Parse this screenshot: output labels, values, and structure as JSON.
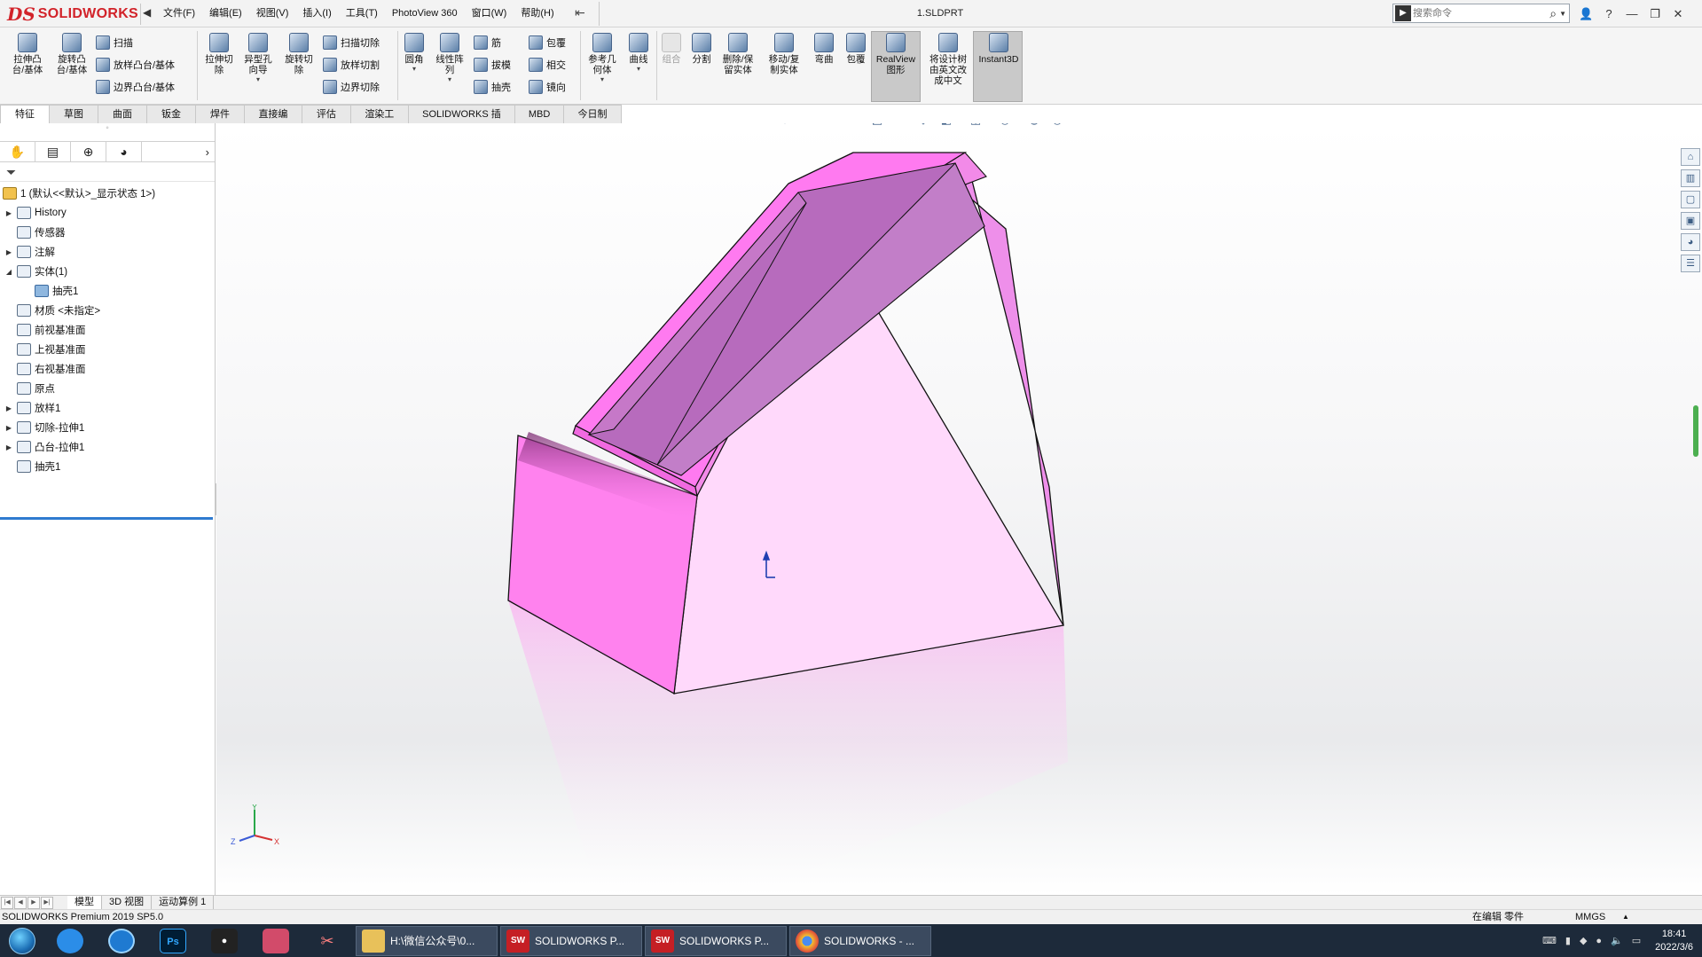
{
  "app": {
    "logo_ds": "DS",
    "logo_text": "SOLIDWORKS",
    "doc_title": "1.SLDPRT"
  },
  "menu": [
    "文件(F)",
    "编辑(E)",
    "视图(V)",
    "插入(I)",
    "工具(T)",
    "PhotoView 360",
    "窗口(W)",
    "帮助(H)"
  ],
  "search": {
    "placeholder": "搜索命令"
  },
  "window_buttons": [
    "?",
    "—",
    "❐",
    "✕"
  ],
  "ribbon": {
    "extrude_boss": "拉伸凸\n台/基体",
    "revolve_boss": "旋转凸\n台/基体",
    "sweep": "扫描",
    "loft_boss": "放样凸台/基体",
    "boundary_boss": "边界凸台/基体",
    "extrude_cut": "拉伸切\n除",
    "hole_wizard": "异型孔\n向导",
    "revolve_cut": "旋转切\n除",
    "sweep_cut": "扫描切除",
    "loft_cut": "放样切割",
    "boundary_cut": "边界切除",
    "fillet": "圆角",
    "linear_pattern": "线性阵\n列",
    "rib": "筋",
    "draft": "拔模",
    "shell": "抽壳",
    "wrap": "包覆",
    "intersect": "相交",
    "mirror": "镜向",
    "ref_geometry": "参考几\n何体",
    "curves": "曲线",
    "combine": "组合",
    "split": "分割",
    "delete_keep": "删除/保\n留实体",
    "move_copy": "移动/复\n制实体",
    "flex": "弯曲",
    "wrap2": "包覆",
    "realview": "RealView\n图形",
    "translate_tree": "将设计树\n由英文改\n成中文",
    "instant3d": "Instant3D"
  },
  "tabs": [
    "特征",
    "草图",
    "曲面",
    "钣金",
    "焊件",
    "直接编辑",
    "评估",
    "渲染工具",
    "SOLIDWORKS 插件",
    "MBD",
    "今日制造"
  ],
  "tree": {
    "root": "1  (默认<<默认>_显示状态 1>)",
    "items": [
      {
        "label": "History",
        "expandable": true,
        "indent": 1
      },
      {
        "label": "传感器",
        "expandable": false,
        "indent": 1
      },
      {
        "label": "注解",
        "expandable": true,
        "indent": 1
      },
      {
        "label": "实体(1)",
        "expandable": true,
        "expanded": true,
        "indent": 1
      },
      {
        "label": "抽壳1",
        "expandable": false,
        "indent": 2,
        "icon": "blue"
      },
      {
        "label": "材质 <未指定>",
        "expandable": false,
        "indent": 1
      },
      {
        "label": "前视基准面",
        "expandable": false,
        "indent": 1
      },
      {
        "label": "上视基准面",
        "expandable": false,
        "indent": 1
      },
      {
        "label": "右视基准面",
        "expandable": false,
        "indent": 1
      },
      {
        "label": "原点",
        "expandable": false,
        "indent": 1
      },
      {
        "label": "放样1",
        "expandable": true,
        "indent": 1
      },
      {
        "label": "切除-拉伸1",
        "expandable": true,
        "indent": 1
      },
      {
        "label": "凸台-拉伸1",
        "expandable": true,
        "indent": 1
      },
      {
        "label": "抽壳1",
        "expandable": false,
        "indent": 1
      }
    ]
  },
  "viewport": {
    "model_color": "#ff80ee",
    "triad_labels": {
      "x": "X",
      "y": "Y",
      "z": "Z"
    }
  },
  "model_tabs": [
    "模型",
    "3D 视图",
    "运动算例 1"
  ],
  "status": {
    "version": "SOLIDWORKS Premium 2019 SP5.0",
    "editing": "在编辑 零件",
    "units": "MMGS"
  },
  "taskbar": {
    "windows": [
      {
        "label": "H:\\微信公众号\\0...",
        "icon": "folder"
      },
      {
        "label": "SOLIDWORKS P...",
        "icon": "sw2019"
      },
      {
        "label": "SOLIDWORKS P...",
        "icon": "sw2019"
      },
      {
        "label": "SOLIDWORKS - ...",
        "icon": "chrome"
      }
    ],
    "sw_badge": "SW",
    "sw_year": "2019",
    "time": "18:41",
    "date": "2022/3/6"
  }
}
